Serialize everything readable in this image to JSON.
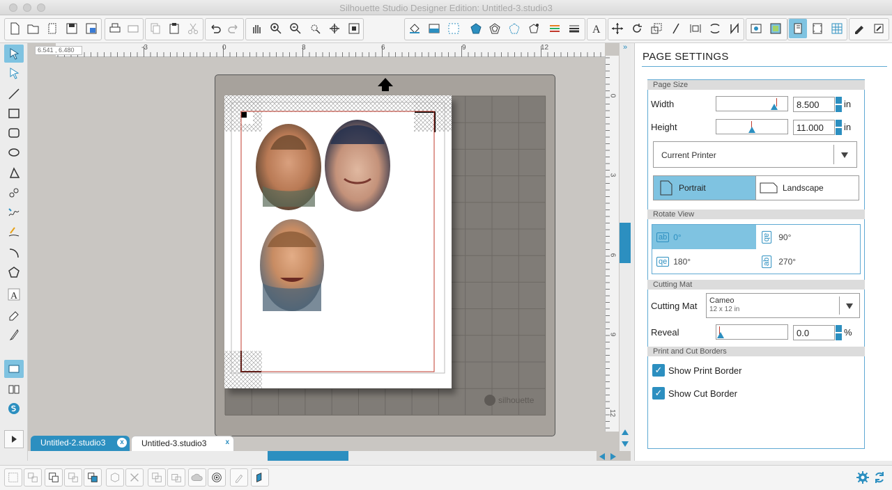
{
  "window": {
    "title": "Silhouette Studio Designer Edition: Untitled-3.studio3"
  },
  "canvas": {
    "coord_readout": "6.541 , 6.480",
    "ruler_h_labels": [
      "-3",
      "0",
      "3",
      "6",
      "9",
      "12"
    ],
    "ruler_v_labels": [
      "0",
      "3",
      "6",
      "9",
      "12"
    ],
    "mat_brand": "silhouette"
  },
  "tabs": [
    {
      "label": "Untitled-2.studio3",
      "close": "x"
    },
    {
      "label": "Untitled-3.studio3",
      "close": "x"
    }
  ],
  "panel": {
    "title": "PAGE SETTINGS",
    "page_size": {
      "section": "Page Size",
      "width_label": "Width",
      "width_value": "8.500",
      "width_unit": "in",
      "width_slider_level": 0.85,
      "height_label": "Height",
      "height_value": "11.000",
      "height_unit": "in",
      "height_slider_level": 0.5,
      "printer": "Current Printer",
      "portrait": "Portrait",
      "landscape": "Landscape"
    },
    "rotate_view": {
      "section": "Rotate View",
      "r0": "0°",
      "r90": "90°",
      "r180": "180°",
      "r270": "270°",
      "icon_0": "ab",
      "icon_90": "ab",
      "icon_180": "qe",
      "icon_270": "ab"
    },
    "cutting_mat": {
      "section": "Cutting Mat",
      "label": "Cutting Mat",
      "mat_name": "Cameo",
      "mat_size": "12 x 12 in",
      "reveal_label": "Reveal",
      "reveal_value": "0.0",
      "reveal_unit": "%",
      "reveal_level": 0.0
    },
    "borders": {
      "section": "Print and Cut Borders",
      "show_print": "Show Print Border",
      "show_cut": "Show Cut Border"
    }
  },
  "colors": {
    "accent": "#2c8fc0",
    "highlight": "#7fc3e1",
    "cut_border": "#c0392b",
    "mat": "#a7a29c"
  }
}
